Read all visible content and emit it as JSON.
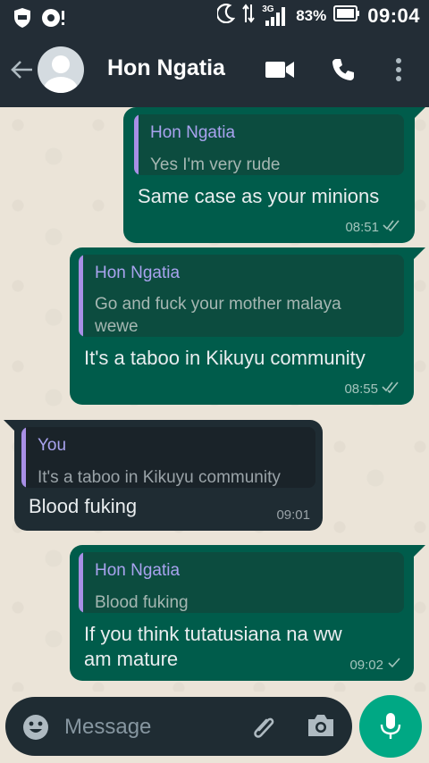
{
  "status_bar": {
    "network": "3G",
    "battery": "83%",
    "time": "09:04"
  },
  "app_bar": {
    "contact_name": "Hon Ngatia"
  },
  "messages": [
    {
      "direction": "outgoing",
      "quote_author": "Hon Ngatia",
      "quote_text": "Yes I'm very rude",
      "text": "Same case as your minions",
      "time": "08:51",
      "status": "read"
    },
    {
      "direction": "outgoing",
      "quote_author": "Hon Ngatia",
      "quote_text_line1": "Go and fuck your mother malaya",
      "quote_text_line2": "wewe",
      "text": "It's a taboo in Kikuyu community",
      "time": "08:55",
      "status": "read"
    },
    {
      "direction": "incoming",
      "quote_author": "You",
      "quote_text": "It's a taboo in Kikuyu community",
      "text": "Blood fuking",
      "time": "09:01"
    },
    {
      "direction": "outgoing",
      "quote_author": "Hon Ngatia",
      "quote_text": "Blood fuking",
      "text_line1": "If you think tutatusiana na ww",
      "text_line2": "am mature",
      "time": "09:02",
      "status": "sent"
    }
  ],
  "input": {
    "placeholder": "Message"
  },
  "colors": {
    "header": "#232d36",
    "outgoing_bubble": "#005c4b",
    "incoming_bubble": "#1f2c33",
    "accent": "#00a884"
  },
  "icons": [
    "shield-icon",
    "notification-icon",
    "moon-icon",
    "data-arrows-icon",
    "signal-icon",
    "battery-icon",
    "back-arrow-icon",
    "avatar-icon",
    "video-call-icon",
    "voice-call-icon",
    "more-options-icon",
    "emoji-icon",
    "attach-icon",
    "camera-icon",
    "mic-icon"
  ]
}
